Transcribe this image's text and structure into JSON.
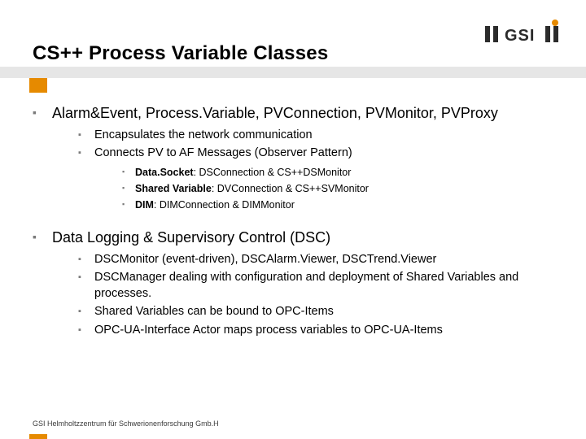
{
  "title": "CS++ Process Variable Classes",
  "footer": "GSI Helmholtzzentrum für Schwerionenforschung Gmb.H",
  "logo": {
    "text": "GSI"
  },
  "section1": {
    "heading": "Alarm&Event, Process.Variable, PVConnection, PVMonitor, PVProxy",
    "sub": [
      "Encapsulates the network communication",
      "Connects PV to AF Messages (Observer Pattern)"
    ],
    "subsub": [
      {
        "b": "Data.Socket",
        "rest": ": DSConnection & CS++DSMonitor"
      },
      {
        "b": "Shared Variable",
        "rest": ": DVConnection & CS++SVMonitor"
      },
      {
        "b": "DIM",
        "rest": ": DIMConnection & DIMMonitor"
      }
    ]
  },
  "section2": {
    "heading": "Data Logging & Supervisory Control (DSC)",
    "sub": [
      "DSCMonitor (event-driven), DSCAlarm.Viewer, DSCTrend.Viewer",
      "DSCManager dealing with configuration and deployment of Shared Variables and processes.",
      "Shared Variables can be bound to OPC-Items",
      "OPC-UA-Interface Actor maps process variables to OPC-UA-Items"
    ]
  }
}
